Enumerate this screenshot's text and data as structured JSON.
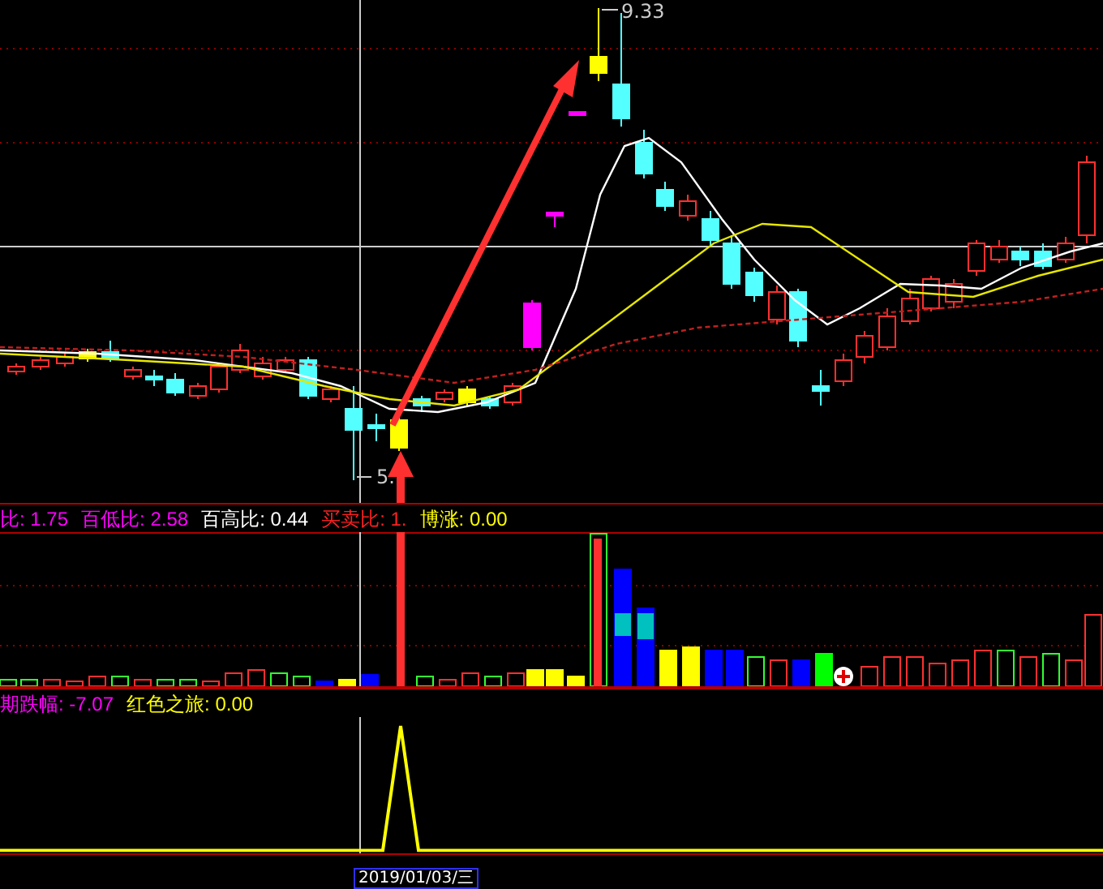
{
  "price_chart": {
    "high_label": "9.33",
    "low_label": "5."
  },
  "indicator_bar": [
    {
      "text": "比: 1.75",
      "kind": "low"
    },
    {
      "text": "百低比: 2.58",
      "kind": "low"
    },
    {
      "text": "百高比: 0.44",
      "kind": "high"
    },
    {
      "text": "买卖比: 1.",
      "kind": "trade"
    },
    {
      "text": "博涨: 0.00",
      "kind": "gain"
    }
  ],
  "signal_bar": [
    {
      "text": "期跌幅: -7.07",
      "kind": "low"
    },
    {
      "text": "红色之旅: 0.00",
      "kind": "gain"
    }
  ],
  "date_tag": "2019/01/03/三"
}
